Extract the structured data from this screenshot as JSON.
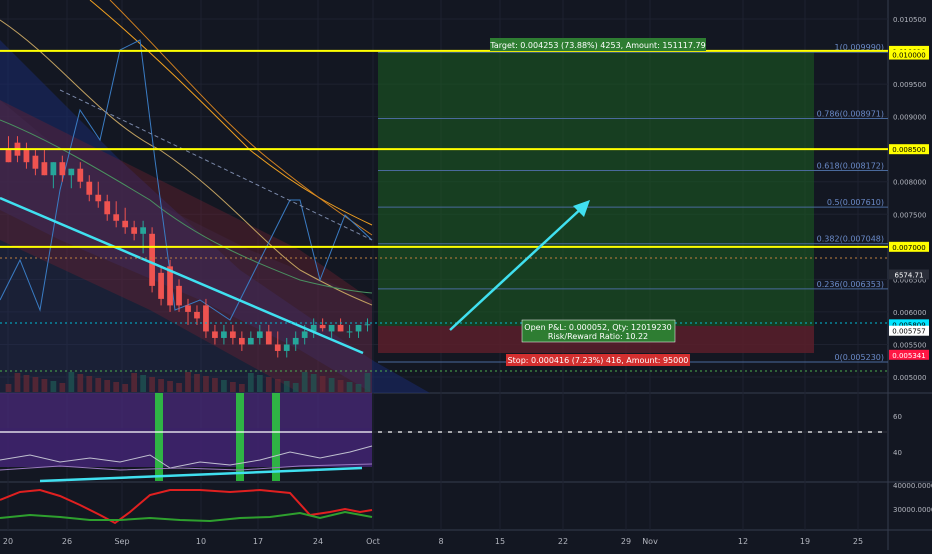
{
  "chart_data": {
    "type": "candlestick",
    "x_ticks": [
      "20",
      "26",
      "Sep",
      "10",
      "17",
      "24",
      "Oct",
      "8",
      "15",
      "22",
      "29",
      "Nov",
      "12",
      "19",
      "25"
    ],
    "y_ticks": [
      "0.010500",
      "0.010000",
      "0.009500",
      "0.009000",
      "0.008500",
      "0.008000",
      "0.007500",
      "0.007000",
      "0.006500",
      "0.006000",
      "0.005500",
      "0.005000"
    ],
    "y_range": [
      0.0048,
      0.0107
    ],
    "candles": [
      {
        "o": 0.0085,
        "h": 0.0087,
        "l": 0.0083,
        "c": 0.0083
      },
      {
        "o": 0.0086,
        "h": 0.0087,
        "l": 0.0083,
        "c": 0.0084
      },
      {
        "o": 0.0085,
        "h": 0.0086,
        "l": 0.0082,
        "c": 0.0083
      },
      {
        "o": 0.0084,
        "h": 0.0085,
        "l": 0.0081,
        "c": 0.0082
      },
      {
        "o": 0.0083,
        "h": 0.0085,
        "l": 0.0081,
        "c": 0.0081
      },
      {
        "o": 0.0081,
        "h": 0.0083,
        "l": 0.0079,
        "c": 0.0083
      },
      {
        "o": 0.0083,
        "h": 0.0084,
        "l": 0.008,
        "c": 0.0081
      },
      {
        "o": 0.0081,
        "h": 0.0082,
        "l": 0.0079,
        "c": 0.0082
      },
      {
        "o": 0.0082,
        "h": 0.0083,
        "l": 0.0079,
        "c": 0.008
      },
      {
        "o": 0.008,
        "h": 0.0081,
        "l": 0.0077,
        "c": 0.0078
      },
      {
        "o": 0.0078,
        "h": 0.008,
        "l": 0.0076,
        "c": 0.0077
      },
      {
        "o": 0.0077,
        "h": 0.0078,
        "l": 0.0074,
        "c": 0.0075
      },
      {
        "o": 0.0075,
        "h": 0.0077,
        "l": 0.0073,
        "c": 0.0074
      },
      {
        "o": 0.0074,
        "h": 0.0076,
        "l": 0.0072,
        "c": 0.0073
      },
      {
        "o": 0.0073,
        "h": 0.0074,
        "l": 0.0071,
        "c": 0.0072
      },
      {
        "o": 0.0072,
        "h": 0.0074,
        "l": 0.0069,
        "c": 0.0073
      },
      {
        "o": 0.0072,
        "h": 0.0073,
        "l": 0.0063,
        "c": 0.0064
      },
      {
        "o": 0.0066,
        "h": 0.0067,
        "l": 0.0061,
        "c": 0.0062
      },
      {
        "o": 0.0067,
        "h": 0.0068,
        "l": 0.006,
        "c": 0.0061
      },
      {
        "o": 0.0064,
        "h": 0.0065,
        "l": 0.006,
        "c": 0.0061
      },
      {
        "o": 0.0061,
        "h": 0.0062,
        "l": 0.0058,
        "c": 0.006
      },
      {
        "o": 0.006,
        "h": 0.0061,
        "l": 0.0058,
        "c": 0.0059
      },
      {
        "o": 0.0061,
        "h": 0.0062,
        "l": 0.0056,
        "c": 0.0057
      },
      {
        "o": 0.0057,
        "h": 0.0058,
        "l": 0.0055,
        "c": 0.0056
      },
      {
        "o": 0.0056,
        "h": 0.0058,
        "l": 0.0055,
        "c": 0.0057
      },
      {
        "o": 0.0057,
        "h": 0.0058,
        "l": 0.0055,
        "c": 0.0056
      },
      {
        "o": 0.0056,
        "h": 0.0057,
        "l": 0.0054,
        "c": 0.0055
      },
      {
        "o": 0.0055,
        "h": 0.0057,
        "l": 0.0055,
        "c": 0.0056
      },
      {
        "o": 0.0056,
        "h": 0.0058,
        "l": 0.0055,
        "c": 0.0057
      },
      {
        "o": 0.0057,
        "h": 0.0058,
        "l": 0.0055,
        "c": 0.0055
      },
      {
        "o": 0.0055,
        "h": 0.0057,
        "l": 0.0053,
        "c": 0.0054
      },
      {
        "o": 0.0054,
        "h": 0.0056,
        "l": 0.0053,
        "c": 0.0055
      },
      {
        "o": 0.0055,
        "h": 0.0057,
        "l": 0.0054,
        "c": 0.0056
      },
      {
        "o": 0.0056,
        "h": 0.0058,
        "l": 0.0055,
        "c": 0.0057
      },
      {
        "o": 0.0057,
        "h": 0.0059,
        "l": 0.0056,
        "c": 0.0058
      },
      {
        "o": 0.0058,
        "h": 0.0059,
        "l": 0.0057,
        "c": 0.00575
      },
      {
        "o": 0.0057,
        "h": 0.0058,
        "l": 0.0056,
        "c": 0.0058
      },
      {
        "o": 0.0058,
        "h": 0.0059,
        "l": 0.0057,
        "c": 0.0057
      },
      {
        "o": 0.0057,
        "h": 0.0058,
        "l": 0.0056,
        "c": 0.0057
      },
      {
        "o": 0.0057,
        "h": 0.0058,
        "l": 0.0056,
        "c": 0.0058
      },
      {
        "o": 0.0058,
        "h": 0.0059,
        "l": 0.0057,
        "c": 0.00581
      }
    ],
    "horizontal_levels": [
      {
        "price": 0.01001,
        "color": "#ffff00",
        "label": "0.010010"
      },
      {
        "price": 0.01,
        "color": "#ffff00",
        "label": "0.010000"
      },
      {
        "price": 0.0085,
        "color": "#ffff00",
        "label": "0.008500"
      },
      {
        "price": 0.007,
        "color": "#ffff00",
        "label": "0.007000"
      }
    ],
    "price_tags": [
      {
        "price": 0.006575,
        "color": "#2a2e39",
        "label": "6574.71"
      },
      {
        "price": 0.005809,
        "color": "#00e5ff",
        "label": "0.005809"
      },
      {
        "price": 0.005757,
        "color": "#ffffff",
        "label": "0.005757"
      },
      {
        "price": 0.005341,
        "color": "#ff1744",
        "label": "0.005341"
      }
    ],
    "fib_levels": [
      {
        "label": "1(0.009990)",
        "price": 0.00999
      },
      {
        "label": "0.786(0.008971)",
        "price": 0.008971
      },
      {
        "label": "0.618(0.008172)",
        "price": 0.008172
      },
      {
        "label": "0.5(0.007610)",
        "price": 0.00761
      },
      {
        "label": "0.382(0.007048)",
        "price": 0.007048
      },
      {
        "label": "0.236(0.006353)",
        "price": 0.006353
      },
      {
        "label": "0(0.005230)",
        "price": 0.00523
      }
    ],
    "position": {
      "entry": 0.005757,
      "target": 0.01001,
      "stop": 0.005341,
      "target_label": "Target: 0.004253 (73.88%) 4253, Amount: 151117.79",
      "stop_label": "Stop: 0.000416 (7.23%) 416, Amount: 95000",
      "pnl_label_1": "Open P&L: 0.000052, Qty: 12019230",
      "pnl_label_2": "Risk/Reward Ratio: 10.22"
    },
    "rsi": {
      "y_ticks": [
        "60",
        "40"
      ],
      "levels": [
        70,
        30
      ]
    },
    "pane3": {
      "y_ticks": [
        "40000.0000",
        "30000.0000"
      ]
    },
    "colors": {
      "up": "#26a69a",
      "down": "#ef5350",
      "target_zone": "#1b5e20",
      "stop_zone": "#5a1e2a",
      "fib": "#4a6a9c",
      "trend": "#40e0f0"
    }
  }
}
